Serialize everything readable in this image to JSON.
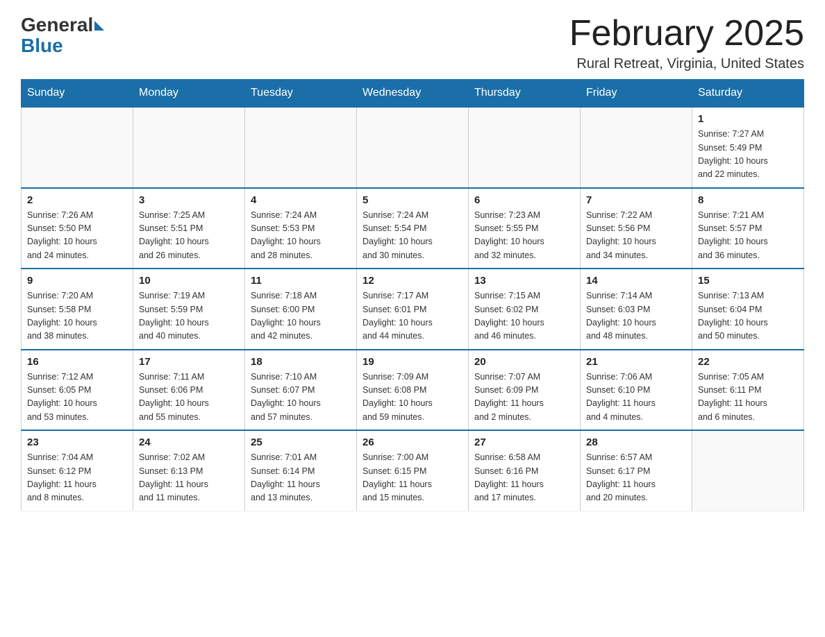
{
  "header": {
    "logo_general": "General",
    "logo_blue": "Blue",
    "title": "February 2025",
    "subtitle": "Rural Retreat, Virginia, United States"
  },
  "days_of_week": [
    "Sunday",
    "Monday",
    "Tuesday",
    "Wednesday",
    "Thursday",
    "Friday",
    "Saturday"
  ],
  "weeks": [
    [
      {
        "day": "",
        "info": ""
      },
      {
        "day": "",
        "info": ""
      },
      {
        "day": "",
        "info": ""
      },
      {
        "day": "",
        "info": ""
      },
      {
        "day": "",
        "info": ""
      },
      {
        "day": "",
        "info": ""
      },
      {
        "day": "1",
        "info": "Sunrise: 7:27 AM\nSunset: 5:49 PM\nDaylight: 10 hours\nand 22 minutes."
      }
    ],
    [
      {
        "day": "2",
        "info": "Sunrise: 7:26 AM\nSunset: 5:50 PM\nDaylight: 10 hours\nand 24 minutes."
      },
      {
        "day": "3",
        "info": "Sunrise: 7:25 AM\nSunset: 5:51 PM\nDaylight: 10 hours\nand 26 minutes."
      },
      {
        "day": "4",
        "info": "Sunrise: 7:24 AM\nSunset: 5:53 PM\nDaylight: 10 hours\nand 28 minutes."
      },
      {
        "day": "5",
        "info": "Sunrise: 7:24 AM\nSunset: 5:54 PM\nDaylight: 10 hours\nand 30 minutes."
      },
      {
        "day": "6",
        "info": "Sunrise: 7:23 AM\nSunset: 5:55 PM\nDaylight: 10 hours\nand 32 minutes."
      },
      {
        "day": "7",
        "info": "Sunrise: 7:22 AM\nSunset: 5:56 PM\nDaylight: 10 hours\nand 34 minutes."
      },
      {
        "day": "8",
        "info": "Sunrise: 7:21 AM\nSunset: 5:57 PM\nDaylight: 10 hours\nand 36 minutes."
      }
    ],
    [
      {
        "day": "9",
        "info": "Sunrise: 7:20 AM\nSunset: 5:58 PM\nDaylight: 10 hours\nand 38 minutes."
      },
      {
        "day": "10",
        "info": "Sunrise: 7:19 AM\nSunset: 5:59 PM\nDaylight: 10 hours\nand 40 minutes."
      },
      {
        "day": "11",
        "info": "Sunrise: 7:18 AM\nSunset: 6:00 PM\nDaylight: 10 hours\nand 42 minutes."
      },
      {
        "day": "12",
        "info": "Sunrise: 7:17 AM\nSunset: 6:01 PM\nDaylight: 10 hours\nand 44 minutes."
      },
      {
        "day": "13",
        "info": "Sunrise: 7:15 AM\nSunset: 6:02 PM\nDaylight: 10 hours\nand 46 minutes."
      },
      {
        "day": "14",
        "info": "Sunrise: 7:14 AM\nSunset: 6:03 PM\nDaylight: 10 hours\nand 48 minutes."
      },
      {
        "day": "15",
        "info": "Sunrise: 7:13 AM\nSunset: 6:04 PM\nDaylight: 10 hours\nand 50 minutes."
      }
    ],
    [
      {
        "day": "16",
        "info": "Sunrise: 7:12 AM\nSunset: 6:05 PM\nDaylight: 10 hours\nand 53 minutes."
      },
      {
        "day": "17",
        "info": "Sunrise: 7:11 AM\nSunset: 6:06 PM\nDaylight: 10 hours\nand 55 minutes."
      },
      {
        "day": "18",
        "info": "Sunrise: 7:10 AM\nSunset: 6:07 PM\nDaylight: 10 hours\nand 57 minutes."
      },
      {
        "day": "19",
        "info": "Sunrise: 7:09 AM\nSunset: 6:08 PM\nDaylight: 10 hours\nand 59 minutes."
      },
      {
        "day": "20",
        "info": "Sunrise: 7:07 AM\nSunset: 6:09 PM\nDaylight: 11 hours\nand 2 minutes."
      },
      {
        "day": "21",
        "info": "Sunrise: 7:06 AM\nSunset: 6:10 PM\nDaylight: 11 hours\nand 4 minutes."
      },
      {
        "day": "22",
        "info": "Sunrise: 7:05 AM\nSunset: 6:11 PM\nDaylight: 11 hours\nand 6 minutes."
      }
    ],
    [
      {
        "day": "23",
        "info": "Sunrise: 7:04 AM\nSunset: 6:12 PM\nDaylight: 11 hours\nand 8 minutes."
      },
      {
        "day": "24",
        "info": "Sunrise: 7:02 AM\nSunset: 6:13 PM\nDaylight: 11 hours\nand 11 minutes."
      },
      {
        "day": "25",
        "info": "Sunrise: 7:01 AM\nSunset: 6:14 PM\nDaylight: 11 hours\nand 13 minutes."
      },
      {
        "day": "26",
        "info": "Sunrise: 7:00 AM\nSunset: 6:15 PM\nDaylight: 11 hours\nand 15 minutes."
      },
      {
        "day": "27",
        "info": "Sunrise: 6:58 AM\nSunset: 6:16 PM\nDaylight: 11 hours\nand 17 minutes."
      },
      {
        "day": "28",
        "info": "Sunrise: 6:57 AM\nSunset: 6:17 PM\nDaylight: 11 hours\nand 20 minutes."
      },
      {
        "day": "",
        "info": ""
      }
    ]
  ]
}
